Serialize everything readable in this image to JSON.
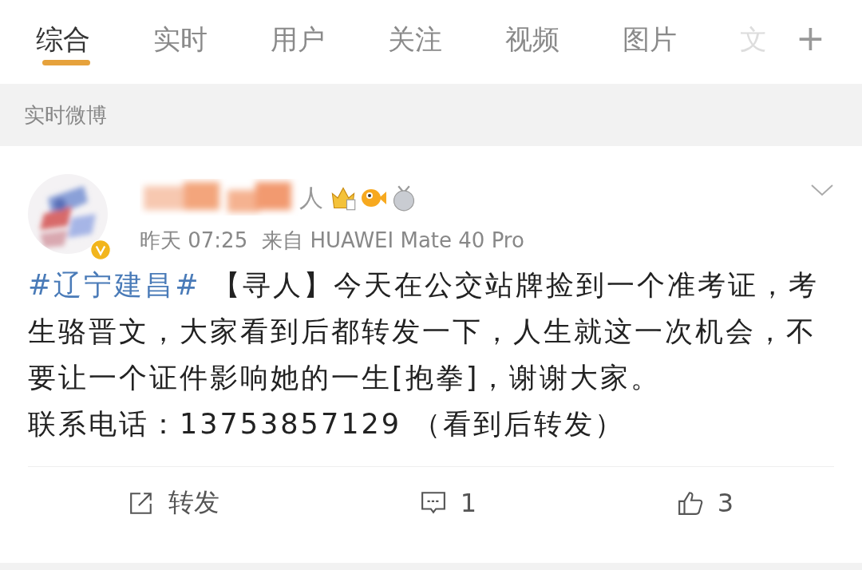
{
  "tabs": [
    {
      "label": "综合",
      "selected": true
    },
    {
      "label": "实时",
      "selected": false
    },
    {
      "label": "用户",
      "selected": false
    },
    {
      "label": "关注",
      "selected": false
    },
    {
      "label": "视频",
      "selected": false
    },
    {
      "label": "图片",
      "selected": false
    },
    {
      "label": "文",
      "selected": false
    }
  ],
  "add_tab": "+",
  "section_title": "实时微博",
  "post": {
    "author_visible": "人",
    "verified": true,
    "time": "昨天 07:25",
    "source": "来自 HUAWEI Mate 40 Pro",
    "hashtag": "#辽宁建昌#",
    "body": "【寻人】今天在公交站牌捡到一个准考证，考生骆晋文，大家看到后都转发一下，人生就这一次机会，不要让一个证件影响她的一生[抱拳]，谢谢大家。",
    "contact": "联系电话：13753857129 （看到后转发）",
    "actions": [
      {
        "kind": "repost",
        "label": "转发"
      },
      {
        "kind": "comment",
        "label": "1"
      },
      {
        "kind": "like",
        "label": "3"
      }
    ]
  }
}
